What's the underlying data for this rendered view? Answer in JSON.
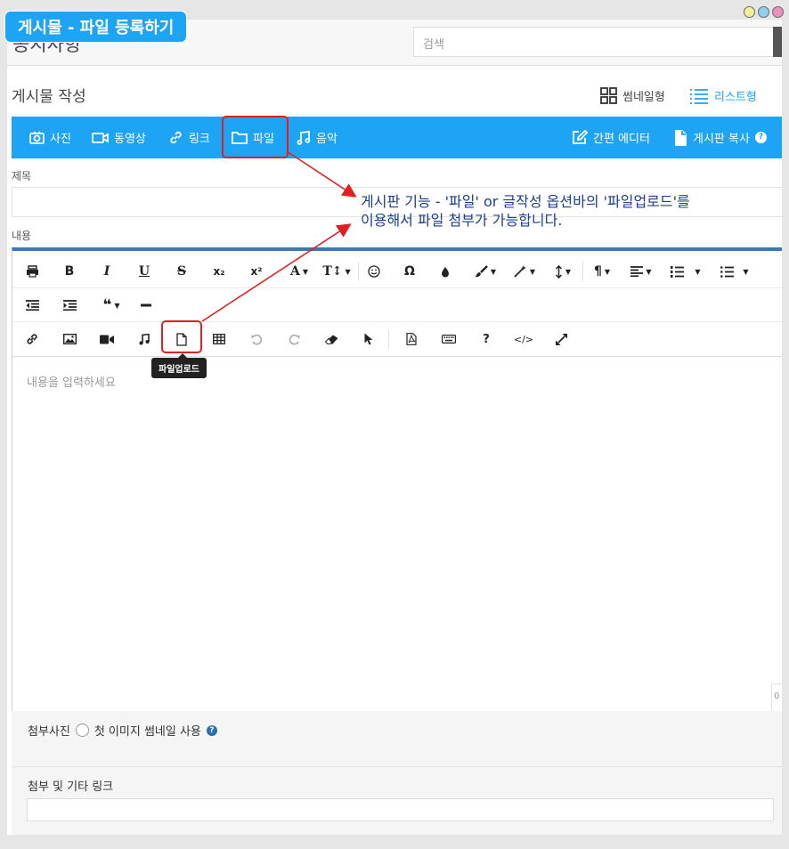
{
  "badge": {
    "text": "게시물 - 파일 등록하기"
  },
  "header": {
    "title_cut": "공지사항",
    "search_placeholder": "검색"
  },
  "write": {
    "title": "게시물 작성",
    "view_thumbnail": "썸네일형",
    "view_list": "리스트형"
  },
  "bluebar": {
    "photo": "사진",
    "video": "동영상",
    "link": "링크",
    "file": "파일",
    "music": "음악",
    "simple_editor": "간편 에디터",
    "copy_board": "게시판 복사"
  },
  "form": {
    "title_label": "제목",
    "content_label": "내용",
    "content_placeholder": "내용을 입력하세요",
    "char_count": "0"
  },
  "toolbar": {
    "tooltip": "파일업로드",
    "bold": "B",
    "italic": "I",
    "underline": "U",
    "strike": "S",
    "subscript": "x₂",
    "superscript": "x²",
    "font_color": "A",
    "font_size": "T↕",
    "omega": "Ω",
    "help": "?",
    "code": "</>"
  },
  "attachments": {
    "photo_label": "첨부사진",
    "thumbnail_option": "첫 이미지 썸네일 사용",
    "link_label": "첨부 및 기타 링크"
  },
  "annotation": {
    "line1": "게시판 기능 - '파일' or  글작성 옵션바의 '파일업로드'를",
    "line2": "이용해서 파일 첨부가 가능합니다."
  },
  "colors": {
    "accent": "#1ea4f5",
    "annotation": "#1a3e8a",
    "highlight": "#e02020"
  }
}
